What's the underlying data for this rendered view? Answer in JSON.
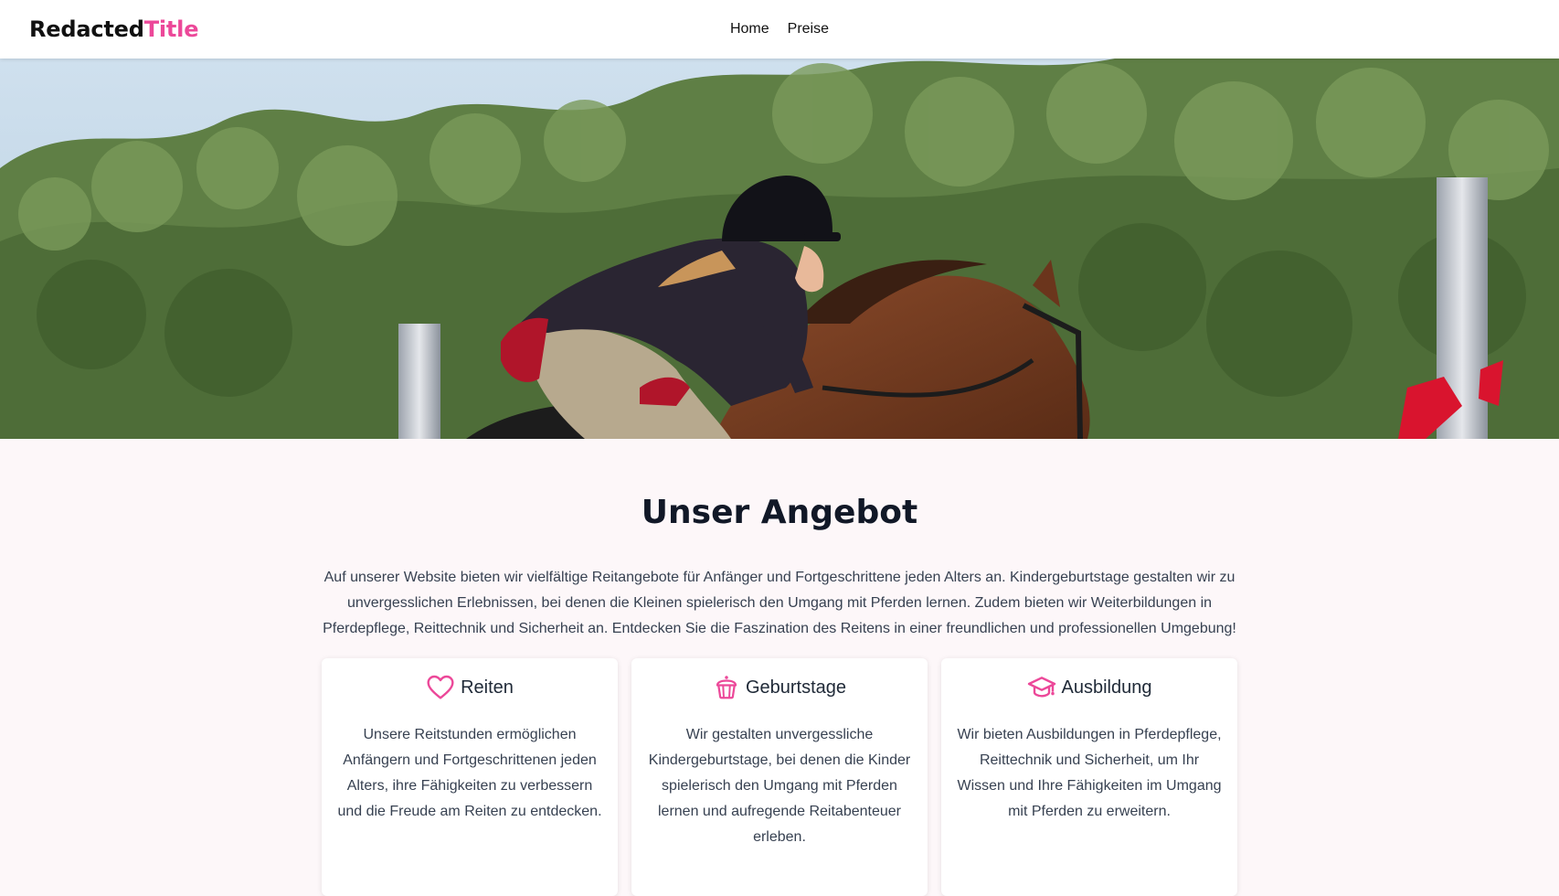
{
  "header": {
    "brand_part1": "Redacted",
    "brand_part2": "Title",
    "nav": [
      {
        "label": "Home"
      },
      {
        "label": "Preise"
      }
    ]
  },
  "colors": {
    "accent": "#ec4899",
    "header_bg": "#ffffff",
    "page_bg": "#fdf7f9",
    "heading": "#111827"
  },
  "hero": {
    "image": "show-jumping-rider-on-brown-horse"
  },
  "main": {
    "title": "Unser Angebot",
    "intro": "Auf unserer Website bieten wir vielfältige Reitangebote für Anfänger und Fortgeschrittene jeden Alters an. Kindergeburtstage gestalten wir zu unvergesslichen Erlebnissen, bei denen die Kleinen spielerisch den Umgang mit Pferden lernen. Zudem bieten wir Weiterbildungen in Pferdepflege, Reittechnik und Sicherheit an. Entdecken Sie die Faszination des Reitens in einer freundlichen und professionellen Umgebung!",
    "cards": [
      {
        "icon": "heart-icon",
        "title": "Reiten",
        "text": "Unsere Reitstunden ermöglichen Anfängern und Fortgeschrittenen jeden Alters, ihre Fähigkeiten zu verbessern und die Freude am Reiten zu entdecken."
      },
      {
        "icon": "cake-icon",
        "title": "Geburtstage",
        "text": "Wir gestalten unvergessliche Kindergeburtstage, bei denen die Kinder spielerisch den Umgang mit Pferden lernen und aufregende Reitabenteuer erleben."
      },
      {
        "icon": "graduation-cap-icon",
        "title": "Ausbildung",
        "text": "Wir bieten Ausbildungen in Pferdepflege, Reittechnik und Sicherheit, um Ihr Wissen und Ihre Fähigkeiten im Umgang mit Pferden zu erweitern."
      }
    ]
  }
}
